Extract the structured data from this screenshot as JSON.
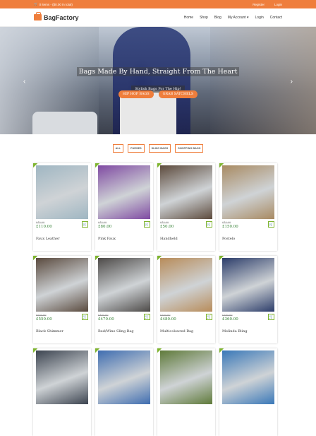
{
  "topbar": {
    "cart": "0 items - ($0.00 in total)",
    "register": "Register",
    "login": "Login"
  },
  "nav": {
    "logo": "BagFactory",
    "items": [
      "Home",
      "Shop",
      "Blog",
      "My Account ▾",
      "Login",
      "Contact"
    ]
  },
  "hero": {
    "title": "Bags Made By Hand, Straight From The Heart",
    "subtitle": "Stylish Bags For The Hip!",
    "buttons": [
      "HIP HOP BAGS",
      "GRAB SATCHELS"
    ],
    "prev_icon": "‹",
    "next_icon": "›"
  },
  "filters": [
    "ALL",
    "PURSES",
    "SLING BAGS",
    "SHOPPING BAGS"
  ],
  "products": [
    {
      "name": "Faux Leather",
      "old": "£45.00",
      "price": "£110.00",
      "color": "#9fb6c2"
    },
    {
      "name": "Pink Faux",
      "old": "£45.00",
      "price": "£80.00",
      "color": "#7f4aa2"
    },
    {
      "name": "Handheld",
      "old": "£45.00",
      "price": "£50.00",
      "color": "#5d4b3d"
    },
    {
      "name": "Postelo",
      "old": "£45.00",
      "price": "£150.00",
      "color": "#a88a62"
    },
    {
      "name": "Black Shimmer",
      "old": "£650.00",
      "price": "£550.00",
      "color": "#5a4a3e"
    },
    {
      "name": "Red/Wine Sling Bag",
      "old": "£480.00",
      "price": "£470.00",
      "color": "#4d4a48"
    },
    {
      "name": "Multicoloured Bag",
      "old": "£500.00",
      "price": "£480.00",
      "color": "#b88c5a"
    },
    {
      "name": "Melinda Bling",
      "old": "£380.00",
      "price": "£360.00",
      "color": "#2c3d6a"
    },
    {
      "name": "",
      "old": "",
      "price": "",
      "color": "#3c4450"
    },
    {
      "name": "",
      "old": "",
      "price": "",
      "color": "#3f6db0"
    },
    {
      "name": "",
      "old": "",
      "price": "",
      "color": "#5f7a3a"
    },
    {
      "name": "",
      "old": "",
      "price": "",
      "color": "#3a78b8"
    }
  ],
  "colors": {
    "accent": "#ef7e3c",
    "ribbon": "#7fb52f"
  }
}
